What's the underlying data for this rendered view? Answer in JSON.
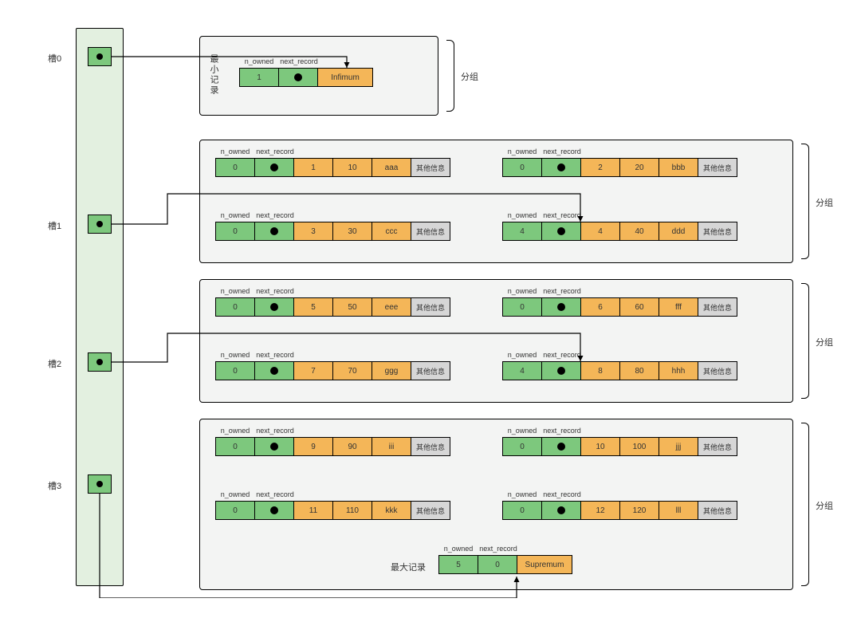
{
  "labels": {
    "n_owned": "n_owned",
    "next_record": "next_record",
    "other": "其他信息",
    "min_record": "最小记录",
    "max_record": "最大记录",
    "group": "分组"
  },
  "slots": {
    "s0": "槽0",
    "s1": "槽1",
    "s2": "槽2",
    "s3": "槽3"
  },
  "infimum": {
    "n_owned": "1",
    "payload": "Infimum"
  },
  "supremum": {
    "n_owned": "5",
    "next": "0",
    "payload": "Supremum"
  },
  "records": {
    "r1": {
      "n_owned": "0",
      "c1": "1",
      "c2": "10",
      "c3": "aaa"
    },
    "r2": {
      "n_owned": "0",
      "c1": "2",
      "c2": "20",
      "c3": "bbb"
    },
    "r3": {
      "n_owned": "0",
      "c1": "3",
      "c2": "30",
      "c3": "ccc"
    },
    "r4": {
      "n_owned": "4",
      "c1": "4",
      "c2": "40",
      "c3": "ddd"
    },
    "r5": {
      "n_owned": "0",
      "c1": "5",
      "c2": "50",
      "c3": "eee"
    },
    "r6": {
      "n_owned": "0",
      "c1": "6",
      "c2": "60",
      "c3": "fff"
    },
    "r7": {
      "n_owned": "0",
      "c1": "7",
      "c2": "70",
      "c3": "ggg"
    },
    "r8": {
      "n_owned": "4",
      "c1": "8",
      "c2": "80",
      "c3": "hhh"
    },
    "r9": {
      "n_owned": "0",
      "c1": "9",
      "c2": "90",
      "c3": "iii"
    },
    "r10": {
      "n_owned": "0",
      "c1": "10",
      "c2": "100",
      "c3": "jjj"
    },
    "r11": {
      "n_owned": "0",
      "c1": "11",
      "c2": "110",
      "c3": "kkk"
    },
    "r12": {
      "n_owned": "0",
      "c1": "12",
      "c2": "120",
      "c3": "lll"
    }
  }
}
